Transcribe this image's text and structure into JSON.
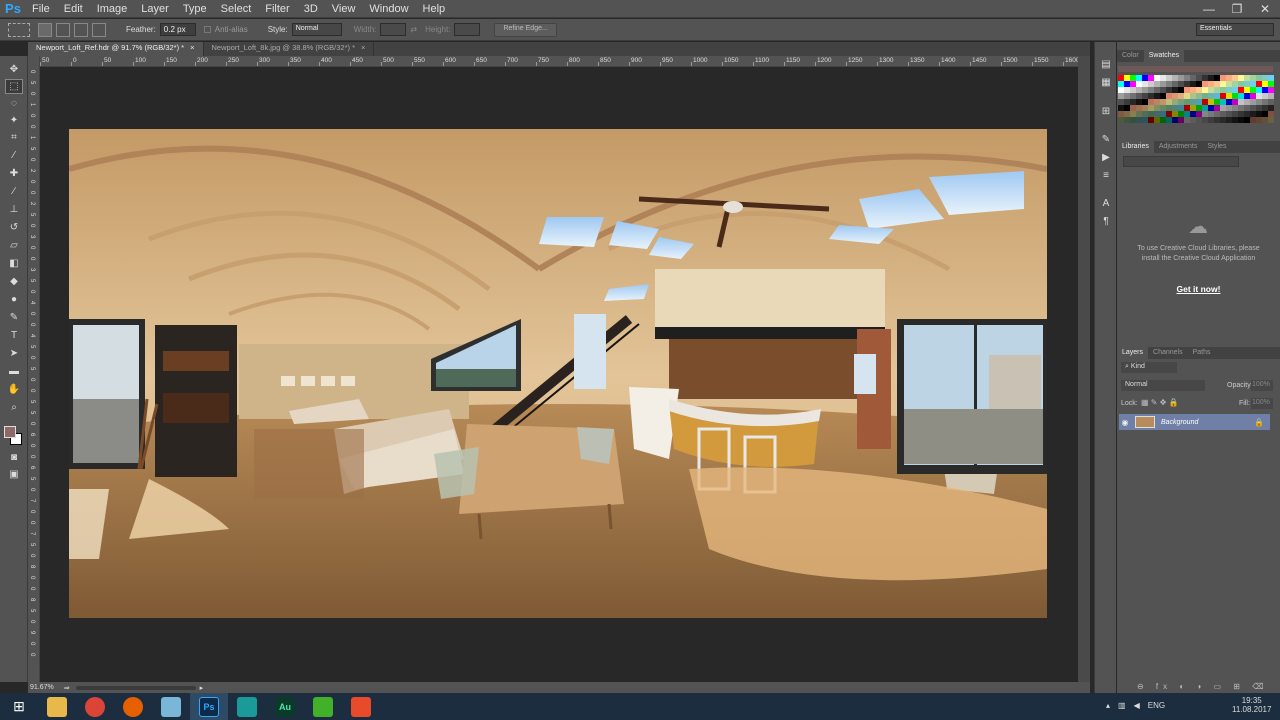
{
  "app": {
    "logo": "Ps"
  },
  "menu": [
    "File",
    "Edit",
    "Image",
    "Layer",
    "Type",
    "Select",
    "Filter",
    "3D",
    "View",
    "Window",
    "Help"
  ],
  "window_controls": [
    "—",
    "❐",
    "✕"
  ],
  "options": {
    "feather_label": "Feather:",
    "feather_value": "0.2 px",
    "antialias_label": "Anti-alias",
    "style_label": "Style:",
    "style_value": "Normal",
    "width_label": "Width:",
    "height_label": "Height:",
    "refine_label": "Refine Edge...",
    "workspace": "Essentials"
  },
  "tabs": [
    {
      "label": "Newport_Loft_Ref.hdr @ 91.7% (RGB/32*) *",
      "close": "×",
      "active": true
    },
    {
      "label": "Newport_Loft_8k.jpg @ 38.8% (RGB/32*) *",
      "close": "×",
      "active": false
    }
  ],
  "ruler_top": [
    "50",
    "0",
    "50",
    "100",
    "150",
    "200",
    "250",
    "300",
    "350",
    "400",
    "450",
    "500",
    "550",
    "600",
    "650",
    "700",
    "750",
    "800",
    "850",
    "900",
    "950",
    "1000",
    "1050",
    "1100",
    "1150",
    "1200",
    "1250",
    "1300",
    "1350",
    "1400",
    "1450",
    "1500",
    "1550",
    "1600"
  ],
  "ruler_left": [
    "0",
    "5",
    "0",
    "1",
    "0",
    "0",
    "1",
    "5",
    "0",
    "2",
    "0",
    "0",
    "2",
    "5",
    "0",
    "3",
    "0",
    "0",
    "3",
    "5",
    "0",
    "4",
    "0",
    "0",
    "4",
    "5",
    "0",
    "5",
    "0",
    "0",
    "5",
    "5",
    "0",
    "6",
    "0",
    "0",
    "6",
    "5",
    "0",
    "7",
    "0",
    "0",
    "7",
    "5",
    "0",
    "8",
    "0",
    "0",
    "8",
    "5",
    "0",
    "9",
    "0",
    "0"
  ],
  "status": {
    "zoom": "91.67%"
  },
  "panels": {
    "color_tabs": [
      "Color",
      "Swatches"
    ],
    "library_tabs": [
      "Libraries",
      "Adjustments",
      "Styles"
    ],
    "cc_message": "To use Creative Cloud Libraries, please install the Creative Cloud Application",
    "cc_link": "Get it now!",
    "layers_tabs": [
      "Layers",
      "Channels",
      "Paths"
    ],
    "kind_label": "Kind",
    "blend_mode": "Normal",
    "opacity_label": "Opacity:",
    "opacity_value": "100%",
    "lock_label": "Lock:",
    "fill_label": "Fill:",
    "fill_value": "100%",
    "layer_name": "Background"
  },
  "taskbar": {
    "apps": [
      "Ps",
      "Au"
    ],
    "language": "ENG",
    "time": "19:35",
    "date": "11.08.2017"
  },
  "colors": {
    "swatches": [
      "#ff0000",
      "#ffff00",
      "#00ff00",
      "#00ffff",
      "#0000ff",
      "#ff00ff",
      "#ffffff",
      "#e6e6e6",
      "#cccccc",
      "#b3b3b3",
      "#999999",
      "#808080",
      "#666666",
      "#4d4d4d",
      "#333333",
      "#1a1a1a",
      "#000000",
      "#f7977a",
      "#f9ad81",
      "#fdc68a",
      "#fff79a",
      "#c4df9b",
      "#a2d39c",
      "#82ca9d",
      "#7bcdc8",
      "#6ecff6"
    ]
  }
}
